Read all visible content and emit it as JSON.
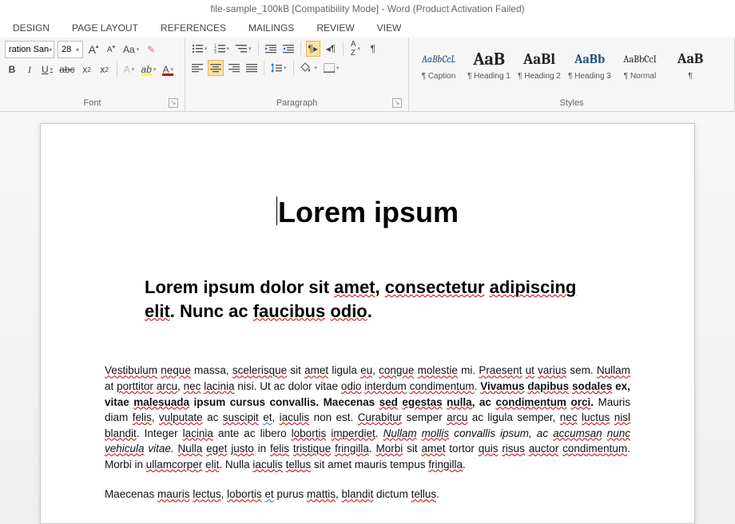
{
  "title": "file-sample_100kB [Compatibility Mode] - Word (Product Activation Failed)",
  "tabs": [
    "DESIGN",
    "PAGE LAYOUT",
    "REFERENCES",
    "MAILINGS",
    "REVIEW",
    "VIEW"
  ],
  "font": {
    "name": "ration San",
    "size": "28",
    "grow": "A",
    "shrink": "A",
    "changecase": "Aa",
    "group_label": "Font"
  },
  "paragraph": {
    "group_label": "Paragraph"
  },
  "styles": {
    "group_label": "Styles",
    "items": [
      {
        "preview": "AaBbCcL",
        "name": "¶ Caption",
        "size": "12px",
        "italic": true,
        "color": "blue"
      },
      {
        "preview": "AaB",
        "name": "¶ Heading 1",
        "size": "22px",
        "bold": true,
        "color": "black"
      },
      {
        "preview": "AaBl",
        "name": "¶ Heading 2",
        "size": "19px",
        "bold": true,
        "color": "black"
      },
      {
        "preview": "AaBb",
        "name": "¶ Heading 3",
        "size": "16px",
        "bold": true,
        "color": "blue"
      },
      {
        "preview": "AaBbCcI",
        "name": "¶ Normal",
        "size": "12px",
        "color": "black"
      },
      {
        "preview": "AaB",
        "name": "¶",
        "size": "18px",
        "bold": true,
        "color": "black"
      }
    ]
  },
  "document": {
    "h1": "Lorem ipsum",
    "h2": "Lorem ipsum dolor sit amet, consectetur adipiscing elit. Nunc ac faucibus odio.",
    "p1": "Vestibulum neque massa, scelerisque sit amet ligula eu, congue molestie mi. Praesent ut varius sem. Nullam at porttitor arcu, nec lacinia nisi. Ut ac dolor vitae odio interdum condimentum. Vivamus dapibus sodales ex, vitae malesuada ipsum cursus convallis. Maecenas sed egestas nulla, ac condimentum orci. Mauris diam felis, vulputate ac suscipit et, iaculis non est. Curabitur semper arcu ac ligula semper, nec luctus nisl blandit. Integer lacinia ante ac libero lobortis imperdiet. Nullam mollis convallis ipsum, ac accumsan nunc vehicula vitae. Nulla eget justo in felis tristique fringilla. Morbi sit amet tortor quis risus auctor condimentum. Morbi in ullamcorper elit. Nulla iaculis tellus sit amet mauris tempus fringilla.",
    "p2": "Maecenas mauris lectus, lobortis et purus mattis, blandit dictum tellus."
  }
}
